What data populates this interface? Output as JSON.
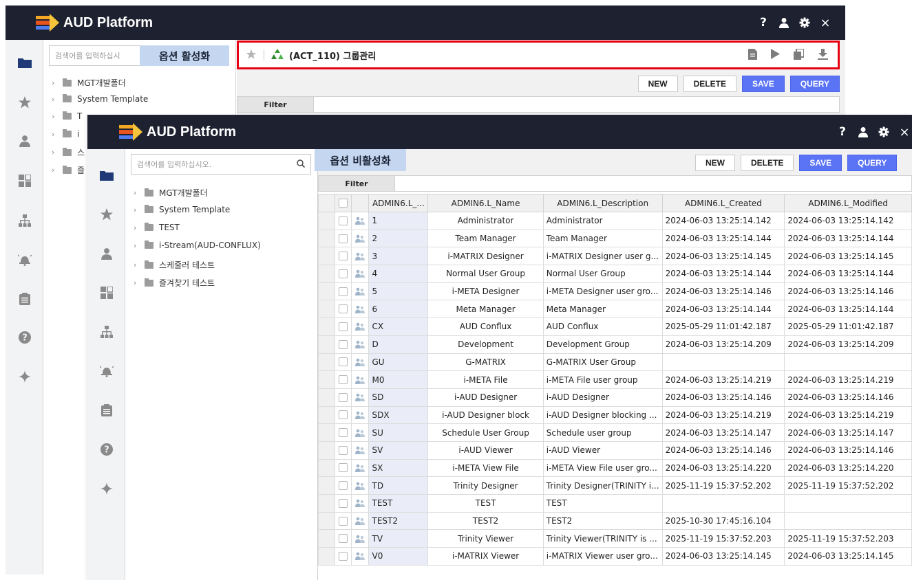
{
  "app": {
    "title": "AUD Platform"
  },
  "topbar_icons": [
    "help-icon",
    "user-icon",
    "settings-icon",
    "close-icon"
  ],
  "topbar_glyphs": {
    "help": "?",
    "close": "×"
  },
  "sidebar_icons": [
    "folder-icon",
    "star-icon",
    "user-icon",
    "dashboard-icon",
    "org-chart-icon",
    "bell-icon",
    "clipboard-icon",
    "help-circle-icon",
    "sparkle-icon"
  ],
  "colors": {
    "topbar": "#1e2130",
    "accent_blue": "#5b73f5",
    "highlight_red": "#e60012",
    "label_bg": "#c5d7f0"
  },
  "back_window": {
    "search_placeholder": "검색어를 입력하십시",
    "option_label": "옵션 활성화",
    "tab_title": "(ACT_110) 그룹관리",
    "tree": [
      "MGT개발폴더",
      "System Template",
      "T",
      "i",
      "스",
      "즐"
    ],
    "buttons": {
      "new": "NEW",
      "delete": "DELETE",
      "save": "SAVE",
      "query": "QUERY"
    },
    "filter_label": "Filter"
  },
  "front_window": {
    "search_placeholder": "검색어를 입력하십시오.",
    "option_label": "옵션 비활성화",
    "tree": [
      "MGT개발폴더",
      "System Template",
      "TEST",
      "i-Stream(AUD-CONFLUX)",
      "스케줄러 테스트",
      "즐겨찾기 테스트"
    ],
    "buttons": {
      "new": "NEW",
      "delete": "DELETE",
      "save": "SAVE",
      "query": "QUERY"
    },
    "filter_label": "Filter",
    "grid": {
      "columns": [
        "ADMIN6.L_...",
        "ADMIN6.L_Name",
        "ADMIN6.L_Description",
        "ADMIN6.L_Created",
        "ADMIN6.L_Modified"
      ],
      "rows": [
        [
          "1",
          "Administrator",
          "Administrator",
          "2024-06-03 13:25:14.142",
          "2024-06-03 13:25:14.142"
        ],
        [
          "2",
          "Team Manager",
          "Team Manager",
          "2024-06-03 13:25:14.144",
          "2024-06-03 13:25:14.144"
        ],
        [
          "3",
          "i-MATRIX Designer",
          "i-MATRIX Designer user g...",
          "2024-06-03 13:25:14.145",
          "2024-06-03 13:25:14.145"
        ],
        [
          "4",
          "Normal User Group",
          "Normal User Group",
          "2024-06-03 13:25:14.144",
          "2024-06-03 13:25:14.144"
        ],
        [
          "5",
          "i-META Designer",
          "i-META Designer user gro...",
          "2024-06-03 13:25:14.146",
          "2024-06-03 13:25:14.146"
        ],
        [
          "6",
          "Meta Manager",
          "Meta Manager",
          "2024-06-03 13:25:14.144",
          "2024-06-03 13:25:14.144"
        ],
        [
          "CX",
          "AUD Conflux",
          "AUD Conflux",
          "2025-05-29 11:01:42.187",
          "2025-05-29 11:01:42.187"
        ],
        [
          "D",
          "Development",
          "Development Group",
          "2024-06-03 13:25:14.209",
          "2024-06-03 13:25:14.209"
        ],
        [
          "GU",
          "G-MATRIX",
          "G-MATRIX User Group",
          "",
          ""
        ],
        [
          "M0",
          "i-META File",
          "i-META File user group",
          "2024-06-03 13:25:14.219",
          "2024-06-03 13:25:14.219"
        ],
        [
          "SD",
          "i-AUD Designer",
          "i-AUD Designer",
          "2024-06-03 13:25:14.146",
          "2024-06-03 13:25:14.146"
        ],
        [
          "SDX",
          "i-AUD Designer block",
          "i-AUD Designer blocking ...",
          "2024-06-03 13:25:14.219",
          "2024-06-03 13:25:14.219"
        ],
        [
          "SU",
          "Schedule User Group",
          "Schedule user group",
          "2024-06-03 13:25:14.147",
          "2024-06-03 13:25:14.147"
        ],
        [
          "SV",
          "i-AUD Viewer",
          "i-AUD Viewer",
          "2024-06-03 13:25:14.146",
          "2024-06-03 13:25:14.146"
        ],
        [
          "SX",
          "i-META View File",
          "i-META View File user gro...",
          "2024-06-03 13:25:14.220",
          "2024-06-03 13:25:14.220"
        ],
        [
          "TD",
          "Trinity Designer",
          "Trinity Designer(TRINITY i...",
          "2025-11-19 15:37:52.202",
          "2025-11-19 15:37:52.202"
        ],
        [
          "TEST",
          "TEST",
          "TEST",
          "",
          ""
        ],
        [
          "TEST2",
          "TEST2",
          "TEST2",
          "2025-10-30 17:45:16.104",
          ""
        ],
        [
          "TV",
          "Trinity Viewer",
          "Trinity Viewer(TRINITY is ...",
          "2025-11-19 15:37:52.203",
          "2025-11-19 15:37:52.203"
        ],
        [
          "V0",
          "i-MATRIX Viewer",
          "i-MATRIX Viewer user gro...",
          "2024-06-03 13:25:14.145",
          "2024-06-03 13:25:14.145"
        ]
      ]
    }
  }
}
